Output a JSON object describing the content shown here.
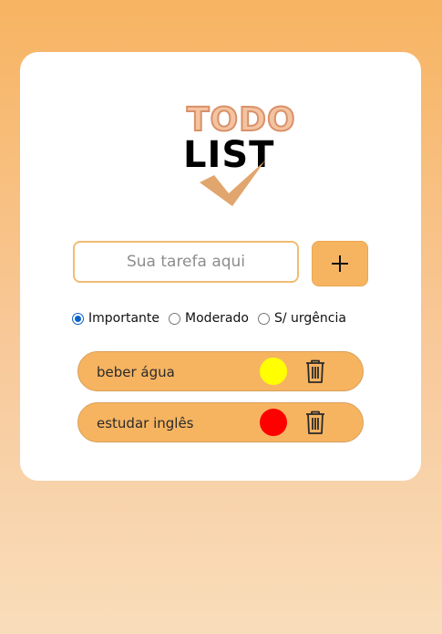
{
  "logo": {
    "line1": "TODO",
    "line2": "LIST",
    "check_icon": "checkmark-icon"
  },
  "form": {
    "input_placeholder": "Sua tarefa aqui",
    "input_value": "",
    "add_icon": "plus-icon"
  },
  "priority": {
    "options": [
      {
        "label": "Importante",
        "checked": true
      },
      {
        "label": "Moderado",
        "checked": false
      },
      {
        "label": "S/ urgência",
        "checked": false
      }
    ]
  },
  "tasks": [
    {
      "text": "beber água",
      "priority_color": "#ffff00",
      "delete_icon": "trash-icon"
    },
    {
      "text": "estudar inglês",
      "priority_color": "#ff0000",
      "delete_icon": "trash-icon"
    }
  ],
  "colors": {
    "accent": "#f6b461",
    "logo_todo": "#f4c3a0",
    "logo_todo_outline": "#d9916a",
    "checkmark": "#e1a66d"
  }
}
